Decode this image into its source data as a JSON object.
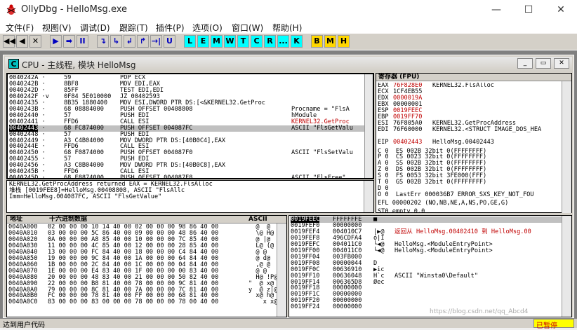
{
  "window": {
    "title": "OllyDbg - HelloMsg.exe"
  },
  "menu": [
    "文件(F)",
    "视图(V)",
    "调试(D)",
    "跟踪(T)",
    "插件(P)",
    "选项(O)",
    "窗口(W)",
    "帮助(H)"
  ],
  "toolbar": {
    "nav": [
      "◀◀",
      "◀",
      "✕"
    ],
    "run": [
      "▶",
      "➡",
      "II"
    ],
    "step": [
      "↴",
      "↳",
      "↲",
      "↱",
      "→|",
      "U"
    ],
    "win": [
      "L",
      "E",
      "M",
      "W",
      "T",
      "C",
      "R",
      "...",
      "K"
    ],
    "misc": [
      "B",
      "M",
      "H"
    ]
  },
  "cpu": {
    "title": "CPU - 主线程, 模块 HelloMsg",
    "icon_letter": "C",
    "buttons": [
      "_",
      "▭",
      "✕"
    ]
  },
  "disasm": {
    "rows": [
      {
        "addr": "0040242A",
        "mark": "·",
        "hex": "59",
        "asm": "POP ECX",
        "comment": ""
      },
      {
        "addr": "0040242B",
        "mark": "·",
        "hex": "8BF8",
        "asm": "MOV EDI,EAX",
        "comment": ""
      },
      {
        "addr": "0040242D",
        "mark": "·",
        "hex": "85FF",
        "asm": "TEST EDI,EDI",
        "comment": ""
      },
      {
        "addr": "0040242F",
        "mark": "·v",
        "hex": "0F84 5E010000",
        "asm": "JZ 00402593",
        "comment": ""
      },
      {
        "addr": "00402435",
        "mark": "·",
        "hex": "8B35 1880400",
        "asm": "MOV ESI,DWORD PTR DS:[<&KERNEL32.GetProc",
        "comment": ""
      },
      {
        "addr": "0040243B",
        "mark": "·",
        "hex": "68 08884000",
        "asm": "PUSH OFFSET 00408808",
        "comment": "Procname = \"FlsA"
      },
      {
        "addr": "00402440",
        "mark": "·",
        "hex": "57",
        "asm": "PUSH EDI",
        "comment": "hModule"
      },
      {
        "addr": "00402441",
        "mark": "·",
        "hex": "FFD6",
        "asm": "CALL ESI",
        "comment": "KERNEL32.GetProc"
      },
      {
        "addr": "00402443",
        "mark": "·",
        "hex": "68 FC874000",
        "asm": "PUSH OFFSET 004087FC",
        "comment": "ASCII \"FlsGetValu"
      },
      {
        "addr": "00402448",
        "mark": "·",
        "hex": "57",
        "asm": "PUSH EDI",
        "comment": ""
      },
      {
        "addr": "00402449",
        "mark": "·",
        "hex": "A3 C4B04000",
        "asm": "MOV DWORD PTR DS:[40B0C4],EAX",
        "comment": ""
      },
      {
        "addr": "0040244E",
        "mark": "·",
        "hex": "FFD6",
        "asm": "CALL ESI",
        "comment": ""
      },
      {
        "addr": "00402450",
        "mark": "·",
        "hex": "68 F0874000",
        "asm": "PUSH OFFSET 004087F0",
        "comment": "ASCII \"FlsSetValu"
      },
      {
        "addr": "00402455",
        "mark": "·",
        "hex": "57",
        "asm": "PUSH EDI",
        "comment": ""
      },
      {
        "addr": "00402456",
        "mark": "·",
        "hex": "A3 C8B04000",
        "asm": "MOV DWORD PTR DS:[40B0C8],EAX",
        "comment": ""
      },
      {
        "addr": "0040245B",
        "mark": "·",
        "hex": "FFD6",
        "asm": "CALL ESI",
        "comment": ""
      },
      {
        "addr": "0040245D",
        "mark": "·",
        "hex": "68 E8874000",
        "asm": "PUSH OFFSET 004087E8",
        "comment": "ASCII \"FlsFree\""
      }
    ],
    "selected_index": 8
  },
  "info": [
    "KERNEL32.GetProcAddress returned EAX = KERNEL32.FlsAlloc",
    "堆栈 [0019FEE8]=HelloMsg.00408808, ASCII \"FlsAllc",
    "Imm=HelloMsg.004087FC, ASCII \"FlsGetValue\""
  ],
  "registers": {
    "header": "寄存器 (FPU)",
    "lines": [
      {
        "name": "EAX",
        "val": "76F828E0",
        "note": "KERNEL32.FlsAlloc",
        "red": true
      },
      {
        "name": "ECX",
        "val": "1CF4EB55",
        "note": "",
        "red": false
      },
      {
        "name": "EDX",
        "val": "0000019A",
        "note": "",
        "red": true
      },
      {
        "name": "EBX",
        "val": "00000001",
        "note": "",
        "red": false
      },
      {
        "name": "ESP",
        "val": "0019FEEC",
        "note": "",
        "red": true
      },
      {
        "name": "EBP",
        "val": "0019FF70",
        "note": "",
        "red": true
      },
      {
        "name": "ESI",
        "val": "76F805A0",
        "note": "KERNEL32.GetProcAddress",
        "red": false
      },
      {
        "name": "EDI",
        "val": "76F60000",
        "note": "KERNEL32.<STRUCT IMAGE_DOS_HEA",
        "red": false
      },
      {
        "name": "",
        "val": "",
        "note": "",
        "red": false
      },
      {
        "name": "EIP",
        "val": "00402443",
        "note": "HelloMsg.00402443",
        "red": true
      }
    ],
    "flags": [
      "C 0  ES 002B 32bit 0(FFFFFFFF)",
      "P 0  CS 0023 32bit 0(FFFFFFFF)",
      "A 0  SS 002B 32bit 0(FFFFFFFF)",
      "Z 0  DS 002B 32bit 0(FFFFFFFF)",
      "S 0  FS 0053 32bit 3FE000(FFF)",
      "T 0  GS 002B 32bit 0(FFFFFFFF)",
      "D 0",
      "O 0  LastErr 000036B7 ERROR_SXS_KEY_NOT_FOU"
    ],
    "efl": "EFL 00000202 (NO,NB,NE,A,NS,PO,GE,G)",
    "st0": "ST0 empty 0.0"
  },
  "dump": {
    "col_addr": "地址",
    "col_hex": "十六进制数据",
    "col_ascii": "ASCII",
    "rows": [
      {
        "addr": "0040A000",
        "hex": "02 00 00 00 10 14 40 00 02 00 00 00 98 86 40 00",
        "ascii": "  @  @"
      },
      {
        "addr": "0040A010",
        "hex": "03 00 00 00 5C 86 40 00 09 00 00 00 48 86 40 00",
        "ascii": "  \\@ H@"
      },
      {
        "addr": "0040A020",
        "hex": "0A 00 00 00 A8 85 40 00 10 00 00 00 7C 85 40 00",
        "ascii": "  @ |@"
      },
      {
        "addr": "0040A030",
        "hex": "11 00 00 00 4C 85 40 00 12 00 00 00 28 85 40 00",
        "ascii": "  L@ (@"
      },
      {
        "addr": "0040A040",
        "hex": "13 00 00 00 FC 84 40 00 18 00 00 00 C4 84 40 00",
        "ascii": "  @ @"
      },
      {
        "addr": "0040A050",
        "hex": "19 00 00 00 9C 84 40 00 1A 00 00 00 64 84 40 00",
        "ascii": "  @ d@"
      },
      {
        "addr": "0040A060",
        "hex": "1B 00 00 00 2C 84 40 00 1C 00 00 00 04 84 40 00",
        "ascii": "  ,@ @"
      },
      {
        "addr": "0040A070",
        "hex": "1E 00 00 00 E4 83 40 00 1F 00 00 00 00 83 40 00",
        "ascii": "  @ @"
      },
      {
        "addr": "0040A080",
        "hex": "20 00 00 00 48 83 40 00 21 00 00 00 50 82 40 00",
        "ascii": "  H@ !P@"
      },
      {
        "addr": "0040A090",
        "hex": "22 00 00 00 B8 81 40 00 78 00 00 00 9C 81 40 00",
        "ascii": "\"  @ x@"
      },
      {
        "addr": "0040A0A0",
        "hex": "79 00 00 00 8C 81 40 00 7A 00 00 00 7C 81 40 00",
        "ascii": "y  @ z|@"
      },
      {
        "addr": "0040A0B0",
        "hex": "FC 00 00 00 78 81 40 00 FF 00 00 00 68 81 40 00",
        "ascii": "  x@ h@"
      },
      {
        "addr": "0040A0C0",
        "hex": "83 00 00 00 83 00 00 00 78 00 00 00 78 00 40 00",
        "ascii": "    x x@"
      }
    ]
  },
  "stack": {
    "rows": [
      {
        "addr": "0019FEEC",
        "val": "FFFFFFFE",
        "mark": "■",
        "note": ""
      },
      {
        "addr": "0019FEF0",
        "val": "00000000",
        "mark": "",
        "note": ""
      },
      {
        "addr": "0019FEF4",
        "val": "004010C7",
        "mark": "|▶@",
        "note": "返回从 HelloMsg.00402410 到 HelloMsg.00"
      },
      {
        "addr": "0019FEF8",
        "val": "496CDFA4",
        "mark": "ó|I",
        "note": ""
      },
      {
        "addr": "0019FEFC",
        "val": "004011C0",
        "mark": "└◀@",
        "note": "HelloMsg.<ModuleEntryPoint>"
      },
      {
        "addr": "0019FF00",
        "val": "004011C0",
        "mark": "└◀@",
        "note": "HelloMsg.<ModuleEntryPoint>"
      },
      {
        "addr": "0019FF04",
        "val": "003FB000",
        "mark": "",
        "note": ""
      },
      {
        "addr": "0019FF08",
        "val": "00000044",
        "mark": "D",
        "note": ""
      },
      {
        "addr": "0019FF0C",
        "val": "00636910",
        "mark": "▶ic",
        "note": ""
      },
      {
        "addr": "0019FF10",
        "val": "00636048",
        "mark": "H`c",
        "note": "ASCII \"Winsta0\\Default\""
      },
      {
        "addr": "0019FF14",
        "val": "006365D8",
        "mark": "Øec",
        "note": ""
      },
      {
        "addr": "0019FF18",
        "val": "00000000",
        "mark": "",
        "note": ""
      },
      {
        "addr": "0019FF1C",
        "val": "00000000",
        "mark": "",
        "note": ""
      },
      {
        "addr": "0019FF20",
        "val": "00000000",
        "mark": "",
        "note": ""
      },
      {
        "addr": "0019FF24",
        "val": "00000000",
        "mark": "",
        "note": ""
      }
    ]
  },
  "status": {
    "left": "达到用户代码",
    "right": "已暂停"
  },
  "watermark": "https://blog.csdn.net/qq_Abcd4"
}
